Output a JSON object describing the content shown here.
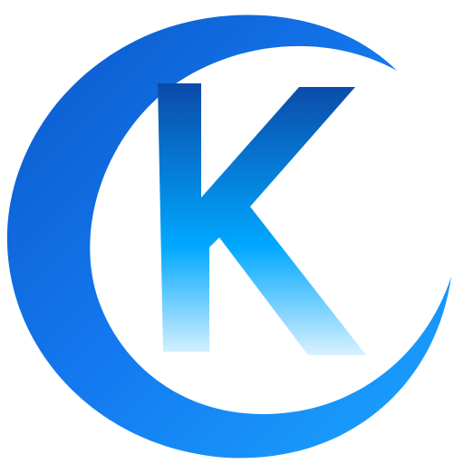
{
  "logo": {
    "letter": "K",
    "colors": {
      "crescent_dark": "#0a58c8",
      "crescent_mid": "#1479f0",
      "crescent_light": "#1aa6ff",
      "letter_top": "#0b4aa8",
      "letter_mid": "#00a8ff",
      "letter_bottom": "#d9f1ff"
    }
  }
}
